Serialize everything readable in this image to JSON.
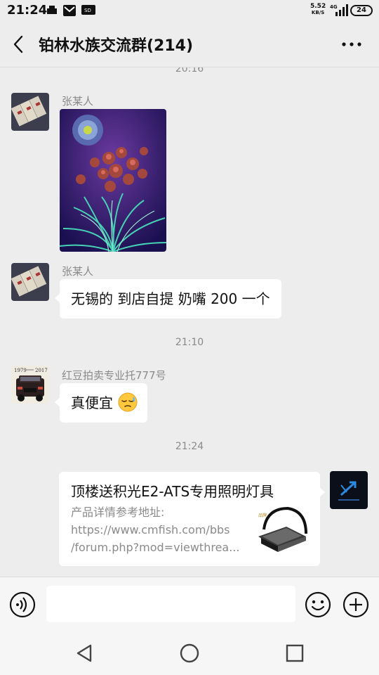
{
  "status_bar": {
    "time": "21:24",
    "net_speed": "5.52",
    "net_unit": "KB/S",
    "signal": "4G",
    "battery": "24"
  },
  "header": {
    "title": "铂林水族交流群(214)"
  },
  "chat": {
    "top_timestamp": "20:16",
    "messages": [
      {
        "sender": "张某人",
        "type": "image",
        "icon": "coral-photo"
      },
      {
        "sender": "张某人",
        "type": "text",
        "text": "无锡的 到店自提 奶嘴 200 一个"
      },
      {
        "sender": "红豆拍卖专业托777号",
        "type": "text",
        "text": "真便宜",
        "emoji": "sleepy-face-emoji"
      }
    ],
    "timestamp_2": "21:10",
    "timestamp_3": "21:24",
    "link_card": {
      "title": "顶楼送积光E2-ATS专用照明灯具",
      "desc_line1": "产品详情参考地址:",
      "desc_line2": "https://www.cmfish.com/bbs",
      "desc_line3": "/forum.php?mod=viewthrea..."
    }
  },
  "colors": {
    "background": "#ededed",
    "bubble": "#ffffff",
    "meta_text": "#8a8a8a"
  }
}
